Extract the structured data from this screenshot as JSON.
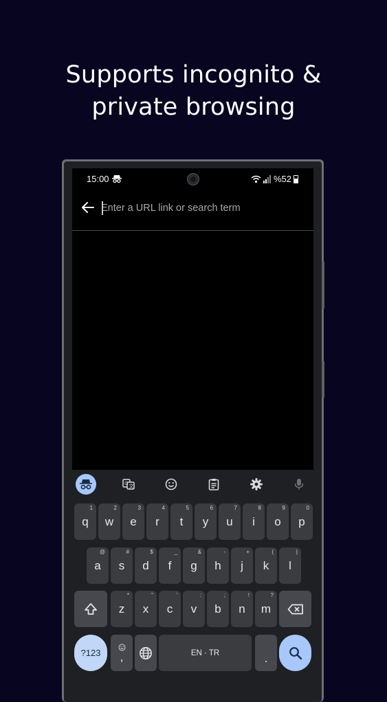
{
  "headline": {
    "line1": "Supports incognito &",
    "line2": "private browsing"
  },
  "status_bar": {
    "time": "15:00",
    "battery": "%52"
  },
  "url_bar": {
    "placeholder": "Enter a URL link or search term"
  },
  "keyboard": {
    "toolbar": [
      "incognito-icon",
      "translate-icon",
      "emoji-icon",
      "clipboard-icon",
      "gear-icon",
      "mic-icon"
    ],
    "row1": [
      {
        "key": "q",
        "hint": "1"
      },
      {
        "key": "w",
        "hint": "2"
      },
      {
        "key": "e",
        "hint": "3"
      },
      {
        "key": "r",
        "hint": "4"
      },
      {
        "key": "t",
        "hint": "5"
      },
      {
        "key": "y",
        "hint": "6"
      },
      {
        "key": "u",
        "hint": "7"
      },
      {
        "key": "i",
        "hint": "8"
      },
      {
        "key": "o",
        "hint": "9"
      },
      {
        "key": "p",
        "hint": "0"
      }
    ],
    "row2": [
      {
        "key": "a",
        "hint": "@"
      },
      {
        "key": "s",
        "hint": "#"
      },
      {
        "key": "d",
        "hint": "$"
      },
      {
        "key": "f",
        "hint": "_"
      },
      {
        "key": "g",
        "hint": "&"
      },
      {
        "key": "h",
        "hint": "-"
      },
      {
        "key": "j",
        "hint": "+"
      },
      {
        "key": "k",
        "hint": "("
      },
      {
        "key": "l",
        "hint": ")"
      }
    ],
    "row3": [
      {
        "key": "z",
        "hint": "*"
      },
      {
        "key": "x",
        "hint": "\""
      },
      {
        "key": "c",
        "hint": "'"
      },
      {
        "key": "v",
        "hint": ":"
      },
      {
        "key": "b",
        "hint": ";"
      },
      {
        "key": "n",
        "hint": "!"
      },
      {
        "key": "m",
        "hint": "?"
      }
    ],
    "symbols_label": "?123",
    "comma_label": ",",
    "space_label": "EN · TR",
    "period_label": ".",
    "accent_color": "#a8c7fa"
  }
}
